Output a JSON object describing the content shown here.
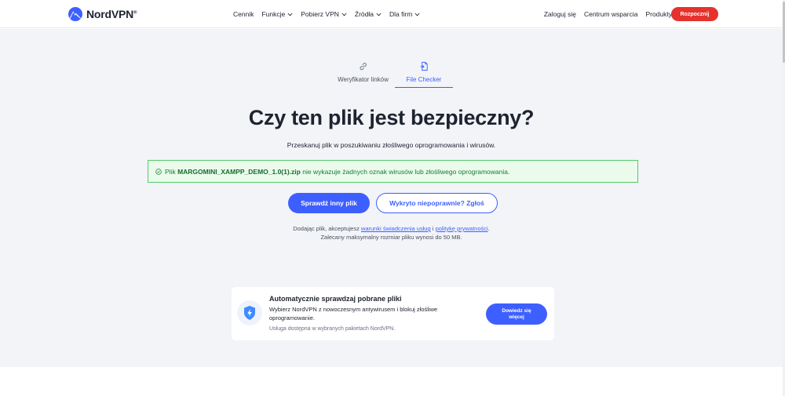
{
  "header": {
    "brand": "NordVPN",
    "brand_mark": "®",
    "nav_left": [
      {
        "label": "Cennik",
        "dropdown": false
      },
      {
        "label": "Funkcje",
        "dropdown": true
      },
      {
        "label": "Pobierz VPN",
        "dropdown": true
      },
      {
        "label": "Źródła",
        "dropdown": true
      },
      {
        "label": "Dla firm",
        "dropdown": true
      }
    ],
    "nav_right": [
      {
        "label": "Zaloguj się",
        "dropdown": false
      },
      {
        "label": "Centrum wsparcia",
        "dropdown": false
      },
      {
        "label": "Produkty",
        "dropdown": true
      }
    ],
    "language_icon": "globe-icon",
    "cta_label": "Rozpocznij",
    "cta_color": "#e5322d"
  },
  "tabs": [
    {
      "label": "Weryfikator linków",
      "icon": "link-icon",
      "active": false
    },
    {
      "label": "File Checker",
      "icon": "file-scan-icon",
      "active": true
    }
  ],
  "main": {
    "title": "Czy ten plik jest bezpieczny?",
    "subtitle": "Przeskanuj plik w poszukiwaniu złośliwego oprogramowania i wirusów.",
    "result": {
      "prefix": "Plik ",
      "filename": "MARGOMINI_XAMPP_DEMO_1.0(1).zip",
      "suffix": " nie wykazuje żadnych oznak wirusów lub złośliwego oprogramowania.",
      "status_color": "#56c96a"
    },
    "primary_button": "Sprawdź inny plik",
    "secondary_button": "Wykryto niepoprawnie? Zgłoś",
    "legal": {
      "text_before": "Dodając plik, akceptujesz ",
      "terms_link": "warunki świadczenia usług",
      "text_middle": " i ",
      "privacy_link": "politykę prywatności",
      "text_after": ".",
      "size_note": "Zalecany maksymalny rozmiar pliku wynosi do 50 MB."
    },
    "accent_color": "#3e5fff"
  },
  "promo": {
    "icon": "shield-lightning-icon",
    "title": "Automatycznie sprawdzaj pobrane pliki",
    "description": "Wybierz NordVPN z nowoczesnym antywirusem i blokuj złośliwe oprogramowanie.",
    "note": "Usługa dostępna w wybranych pakietach NordVPN.",
    "button_label": "Dowiedz się więcej"
  }
}
